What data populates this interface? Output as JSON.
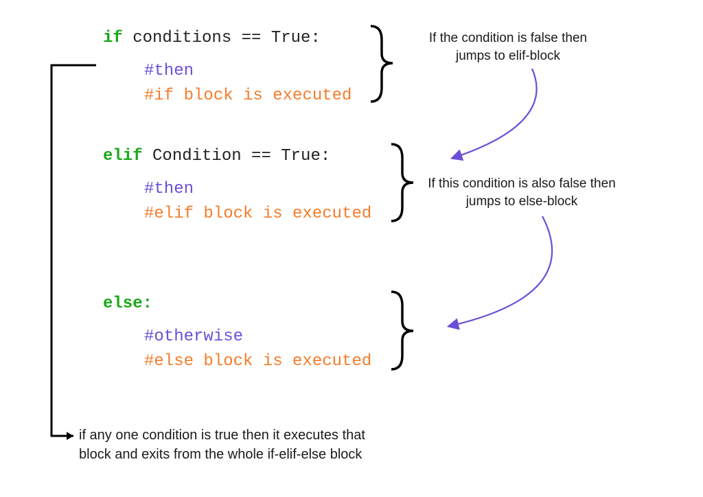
{
  "if_block": {
    "keyword": "if",
    "condition": " conditions == True:",
    "comment1": "#then",
    "comment2": "#if block is executed"
  },
  "elif_block": {
    "keyword": "elif",
    "condition": " Condition == True:",
    "comment1": "#then",
    "comment2": "#elif block is executed"
  },
  "else_block": {
    "keyword": "else:",
    "comment1": "#otherwise",
    "comment2": "#else block is executed"
  },
  "annotations": {
    "if_false": "If the condition is false then\njumps to elif-block",
    "elif_false": "If this condition is also false then\njumps to else-block",
    "bottom": "if any one condition is true then it executes that\nblock and exits from the whole if-elif-else block"
  },
  "colors": {
    "keyword": "#1aa81a",
    "text": "#222222",
    "comment_then": "#6a4fd8",
    "comment_body": "#f57c2a",
    "arrow": "#6a4fd8",
    "brace": "#000000",
    "left_bracket": "#000000"
  }
}
